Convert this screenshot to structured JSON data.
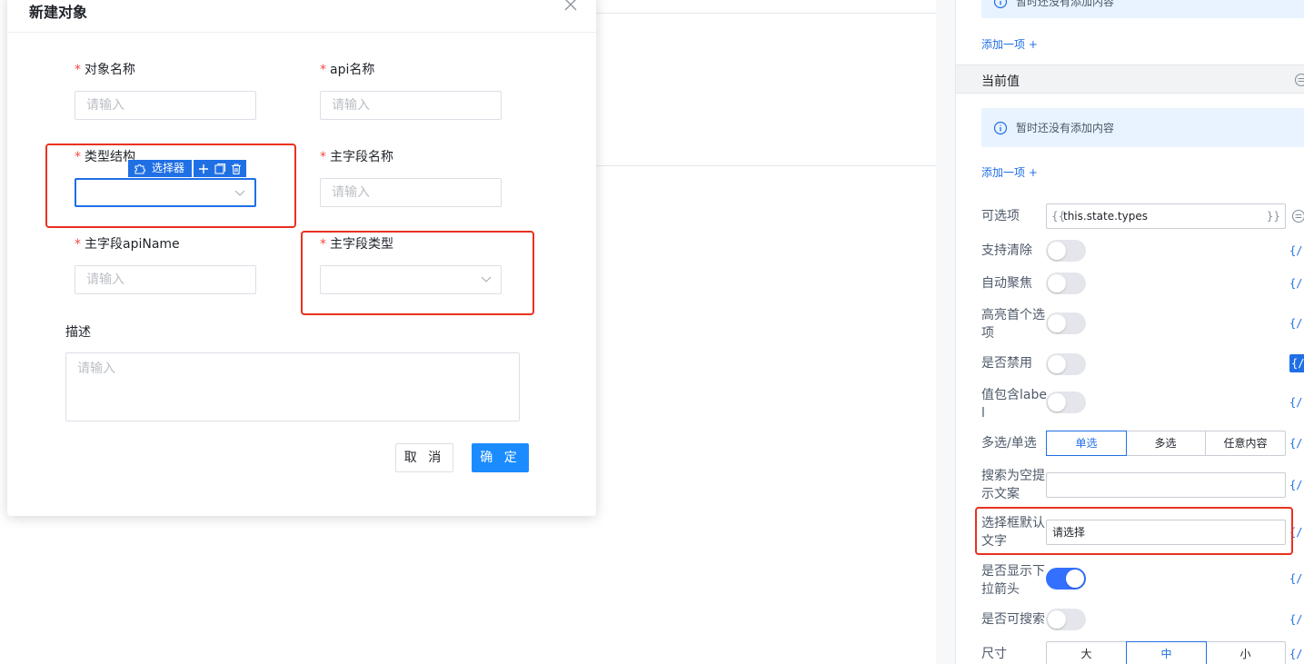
{
  "dialog": {
    "title": "新建对象",
    "close_glyph": "X",
    "fields": {
      "object_name": {
        "label": "对象名称",
        "placeholder": "请输入"
      },
      "api_name": {
        "label": "api名称",
        "placeholder": "请输入"
      },
      "type_structure": {
        "label": "类型结构",
        "value": ""
      },
      "primary_field_name": {
        "label": "主字段名称",
        "placeholder": "请输入"
      },
      "primary_field_api_name": {
        "label": "主字段apiName",
        "placeholder": "请输入"
      },
      "primary_field_type": {
        "label": "主字段类型",
        "value": ""
      },
      "description": {
        "label": "描述",
        "placeholder": "请输入"
      }
    },
    "required_mark": "*",
    "selector_badge": "选择器",
    "cancel_label": "取 消",
    "ok_label": "确 定"
  },
  "panel": {
    "top_info_text": "暂时还没有添加内容",
    "add_item_label": "添加一项 +",
    "current_value_title": "当前值",
    "current_info_text": "暂时还没有添加内容",
    "options": {
      "label": "可选项",
      "left_brace": "{{",
      "value": "this.state.types",
      "right_brace": "}}"
    },
    "props": [
      {
        "label": "支持清除",
        "on": false
      },
      {
        "label": "自动聚焦",
        "on": false
      },
      {
        "label": "高亮首个选项",
        "on": false
      },
      {
        "label": "是否禁用",
        "on": false
      },
      {
        "label": "值包含label",
        "on": false
      }
    ],
    "mode": {
      "label": "多选/单选",
      "options": [
        "单选",
        "多选",
        "任意内容"
      ],
      "selected": "单选"
    },
    "empty_search_text": {
      "label": "搜索为空提示文案",
      "value": ""
    },
    "placeholder_text": {
      "label": "选择框默认文字",
      "value": "请选择"
    },
    "show_arrow": {
      "label": "是否显示下拉箭头",
      "on": true
    },
    "searchable": {
      "label": "是否可搜索",
      "on": false
    },
    "size": {
      "label": "尺寸",
      "options": [
        "大",
        "中",
        "小"
      ],
      "selected": "中"
    },
    "var_glyph": "{/"
  },
  "colors": {
    "primary": "#1a8cff",
    "highlight": "#e8321e",
    "required": "#f54a45",
    "info_bg": "#e8f3ff"
  }
}
